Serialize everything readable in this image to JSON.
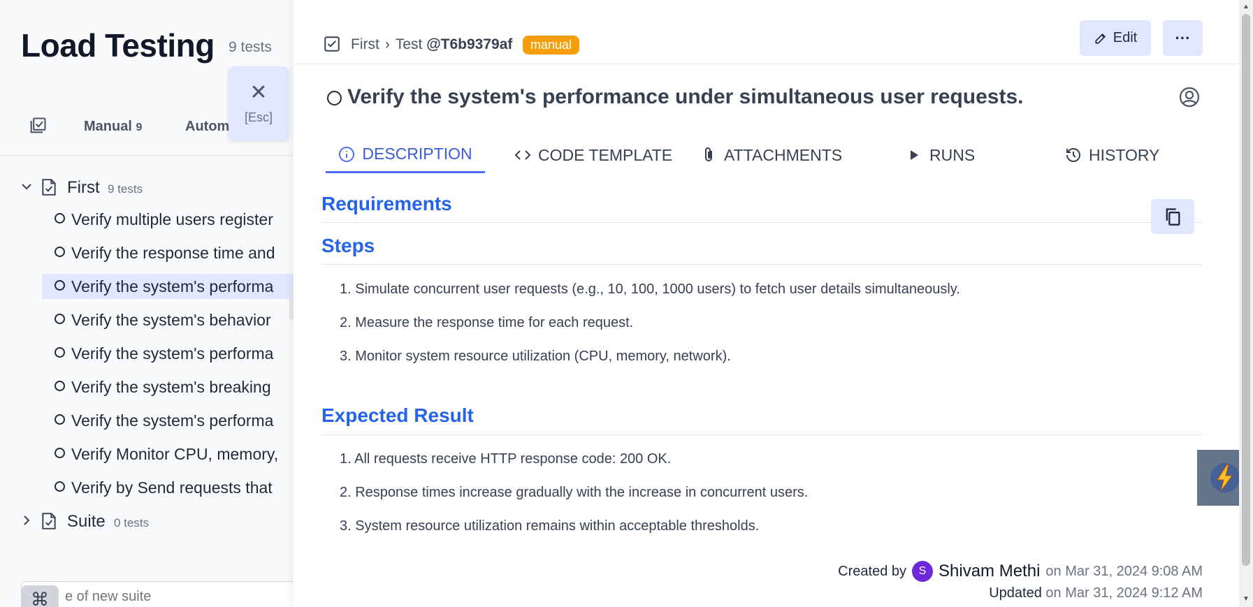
{
  "sidebar": {
    "title": "Load Testing",
    "test_count": "9 tests",
    "close_icon": "close-icon",
    "close_hint": "[Esc]",
    "filters": [
      {
        "label": "Manual",
        "count": "9"
      },
      {
        "label": "Autom",
        "count": ""
      }
    ],
    "suites": [
      {
        "name": "First",
        "count": "9 tests",
        "expanded": true
      },
      {
        "name": "Suite",
        "count": "0 tests",
        "expanded": false
      }
    ],
    "tests": [
      "Verify multiple users register",
      "Verify the response time and",
      "Verify the system's performa",
      "Verify the system's behavior",
      "Verify the system's performa",
      "Verify the system's breaking",
      "Verify the system's performa",
      "Verify Monitor CPU, memory,",
      "Verify by Send requests that"
    ],
    "new_suite_placeholder": "e of new suite",
    "command_symbol": "⌘"
  },
  "header": {
    "breadcrumb_suite": "First",
    "breadcrumb_sep": "›",
    "breadcrumb_test": "Test",
    "test_id": "@T6b9379af",
    "badge": "manual",
    "badge_color": "#f59e0b",
    "edit_label": "Edit",
    "more_label": "···"
  },
  "test": {
    "title": "Verify the system's performance under simultaneous user requests."
  },
  "tabs": [
    {
      "label": "DESCRIPTION",
      "icon": "info-icon",
      "active": true
    },
    {
      "label": "CODE TEMPLATE",
      "icon": "code-icon",
      "active": false
    },
    {
      "label": "ATTACHMENTS",
      "icon": "paperclip-icon",
      "active": false
    },
    {
      "label": "RUNS",
      "icon": "play-icon",
      "active": false
    },
    {
      "label": "HISTORY",
      "icon": "history-icon",
      "active": false
    }
  ],
  "description": {
    "requirements_heading": "Requirements",
    "steps_heading": "Steps",
    "steps": [
      "1. Simulate concurrent user requests (e.g., 10, 100, 1000 users) to fetch user details simultaneously.",
      "2. Measure the response time for each request.",
      "3. Monitor system resource utilization (CPU, memory, network)."
    ],
    "expected_heading": "Expected Result",
    "expected": [
      "1. All requests receive HTTP response code: 200 OK.",
      "2. Response times increase gradually with the increase in concurrent users.",
      "3. System resource utilization remains within acceptable thresholds."
    ]
  },
  "meta": {
    "created_label": "Created by",
    "avatar_initial": "S",
    "author": "Shivam Methi",
    "created_date": "on Mar 31, 2024 9:08 AM",
    "updated_label": "Updated",
    "updated_date": "on Mar 31, 2024 9:12 AM"
  },
  "colors": {
    "accent": "#2563eb",
    "tab_active": "#3b5bdb",
    "button_bg": "#e0e7ff"
  }
}
